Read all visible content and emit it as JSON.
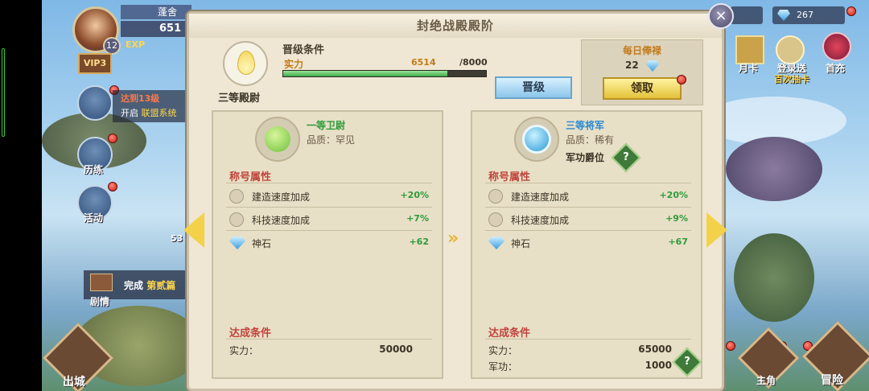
{
  "hud": {
    "player_name": "蓬舍",
    "power": "651",
    "level": "12",
    "exp_label": "EXP",
    "vip": "VIP3",
    "quest_title": "达到13级",
    "quest_open": "开启",
    "quest_target": "联盟系统",
    "side_buttons": [
      {
        "label": "历练"
      },
      {
        "label": "活动"
      }
    ],
    "complete_label": "完成",
    "complete_target": "第贰篇",
    "story_label": "剧情",
    "city_label": "出城",
    "side_number": "53",
    "right": {
      "gem_count": "267",
      "monthly_card": "月卡",
      "login_line1": "登录送",
      "login_line2": "百次抽卡",
      "first_charge": "首充",
      "hero_label": "主角",
      "adventure_label": "冒险"
    }
  },
  "dialog": {
    "title": "封绝战殿殿阶",
    "rank_name": "三等殿尉",
    "cond_title": "晋级条件",
    "cond_label": "实力",
    "cond_value": "6514",
    "cond_max": "/8000",
    "progress": 0.81,
    "upgrade_label": "晋级",
    "daily_title": "每日俸禄",
    "daily_amount": "22",
    "claim_label": "领取",
    "close_icon": "×"
  },
  "cards": [
    {
      "title": "一等卫尉",
      "title_color": "#2e9c3a",
      "quality_label": "品质：",
      "quality": "罕见",
      "attr_header": "称号属性",
      "attrs": [
        {
          "name": "建造速度加成",
          "value": "+20%"
        },
        {
          "name": "科技速度加成",
          "value": "+7%"
        },
        {
          "name": "神石",
          "value": "+62"
        }
      ],
      "req_header": "达成条件",
      "reqs": [
        {
          "label": "实力：",
          "value": "50000"
        }
      ]
    },
    {
      "title": "三等将军",
      "title_color": "#2a8ad0",
      "quality_label": "品质：",
      "quality": "稀有",
      "extra": "军功爵位",
      "attr_header": "称号属性",
      "attrs": [
        {
          "name": "建造速度加成",
          "value": "+20%"
        },
        {
          "name": "科技速度加成",
          "value": "+9%"
        },
        {
          "name": "神石",
          "value": "+67"
        }
      ],
      "req_header": "达成条件",
      "reqs": [
        {
          "label": "实力：",
          "value": "65000"
        },
        {
          "label": "军功：",
          "value": "1000"
        }
      ]
    }
  ],
  "help_label": "?"
}
